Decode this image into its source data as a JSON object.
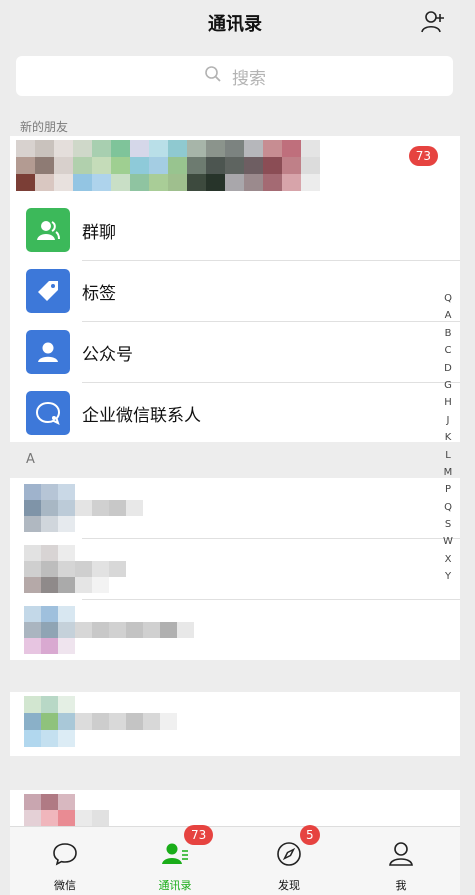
{
  "header": {
    "title": "通讯录",
    "add_icon": "add-contact-icon"
  },
  "search": {
    "placeholder": "搜索",
    "icon": "search-icon"
  },
  "new_friends": {
    "label": "新的朋友",
    "badge": "73"
  },
  "menu": [
    {
      "label": "群聊",
      "icon": "group-chat-icon",
      "color": "#3cb95a"
    },
    {
      "label": "标签",
      "icon": "tag-icon",
      "color": "#3d78d9"
    },
    {
      "label": "公众号",
      "icon": "official-account-icon",
      "color": "#3d78d9"
    },
    {
      "label": "企业微信联系人",
      "icon": "work-contact-icon",
      "color": "#3d78d9"
    }
  ],
  "section_a": "A",
  "index": [
    "Q",
    "A",
    "B",
    "C",
    "D",
    "G",
    "H",
    "J",
    "K",
    "L",
    "M",
    "P",
    "Q",
    "S",
    "W",
    "X",
    "Y"
  ],
  "tabs": [
    {
      "label": "微信",
      "icon": "chat-icon",
      "active": false
    },
    {
      "label": "通讯录",
      "icon": "contacts-icon",
      "active": true,
      "badge": "73"
    },
    {
      "label": "发现",
      "icon": "discover-icon",
      "active": false,
      "badge": "5"
    },
    {
      "label": "我",
      "icon": "me-icon",
      "active": false
    }
  ],
  "colors": {
    "accent": "#1aad19",
    "badge": "#e64340",
    "blue": "#3d78d9",
    "green": "#3cb95a"
  }
}
